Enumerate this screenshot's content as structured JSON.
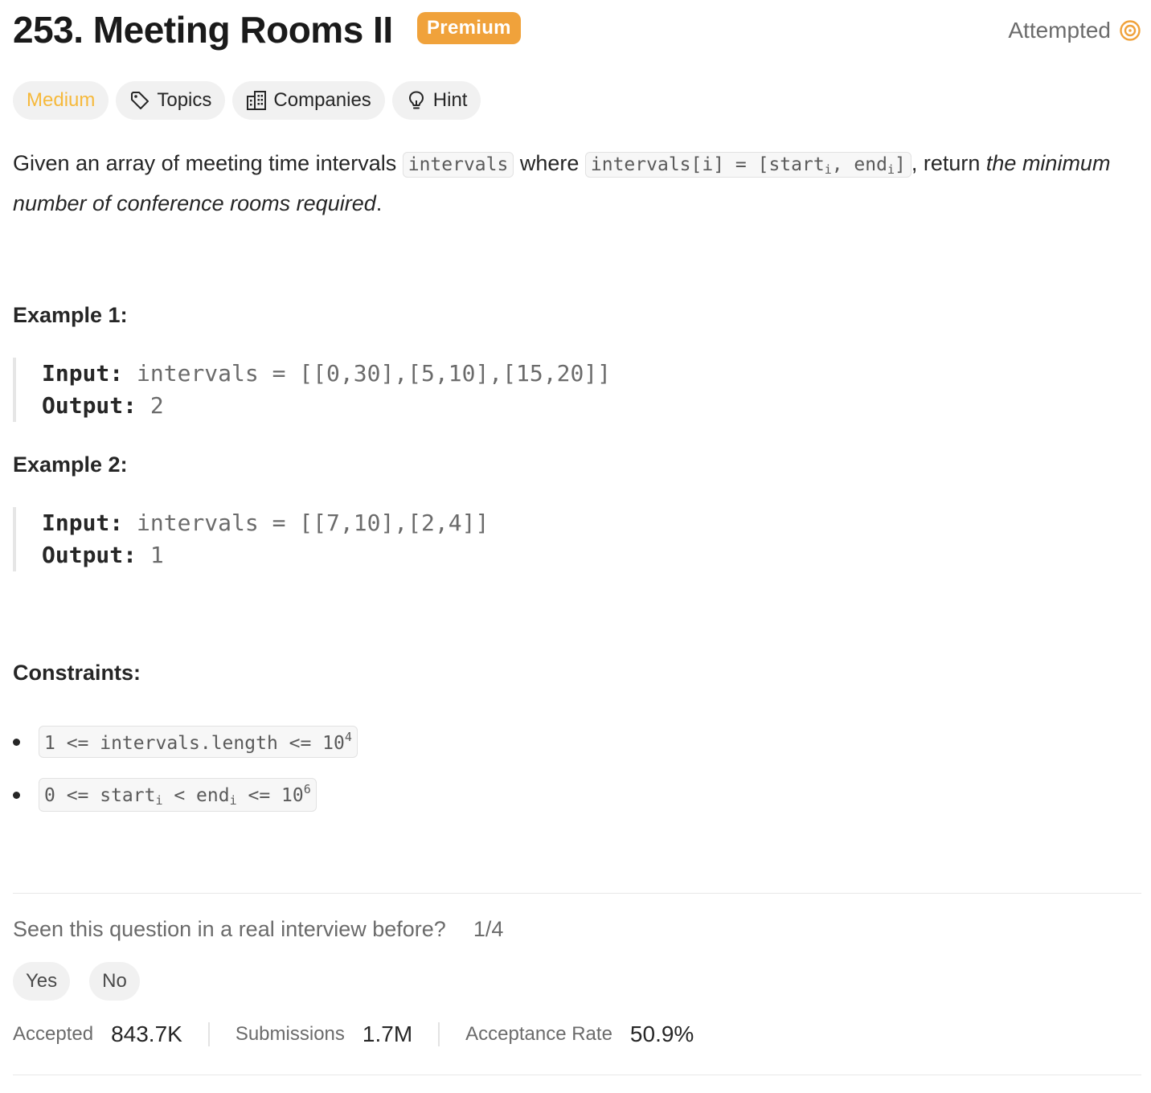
{
  "header": {
    "title": "253. Meeting Rooms II",
    "premium_badge": "Premium",
    "status": "Attempted",
    "accent_color": "#f0a23b"
  },
  "tags": [
    {
      "label": "Medium",
      "icon": ""
    },
    {
      "label": "Topics",
      "icon": "tag-icon"
    },
    {
      "label": "Companies",
      "icon": "building-icon"
    },
    {
      "label": "Hint",
      "icon": "lightbulb-icon"
    }
  ],
  "description": {
    "part1": "Given an array of meeting time intervals ",
    "code1": "intervals",
    "part2": " where ",
    "code2_a": "intervals[i] = [start",
    "code2_sub1": "i",
    "code2_b": ", end",
    "code2_sub2": "i",
    "code2_c": "]",
    "part3": ", return ",
    "emphasis": "the minimum number of conference rooms required",
    "part4": "."
  },
  "examples": [
    {
      "heading": "Example 1:",
      "input_label": "Input:",
      "input_value": "intervals = [[0,30],[5,10],[15,20]]",
      "output_label": "Output:",
      "output_value": "2"
    },
    {
      "heading": "Example 2:",
      "input_label": "Input:",
      "input_value": "intervals = [[7,10],[2,4]]",
      "output_label": "Output:",
      "output_value": "1"
    }
  ],
  "constraints": {
    "heading": "Constraints:",
    "c1_text": "1 <= intervals.length <= 10",
    "c1_sup": "4",
    "c2_a": "0 <= start",
    "c2_sub1": "i",
    "c2_b": " < end",
    "c2_sub2": "i",
    "c2_c": " <= 10",
    "c2_sup": "6"
  },
  "interview": {
    "question": "Seen this question in a real interview before?",
    "progress": "1/4",
    "yes": "Yes",
    "no": "No"
  },
  "stats": {
    "accepted_label": "Accepted",
    "accepted_value": "843.7K",
    "submissions_label": "Submissions",
    "submissions_value": "1.7M",
    "rate_label": "Acceptance Rate",
    "rate_value": "50.9%"
  }
}
